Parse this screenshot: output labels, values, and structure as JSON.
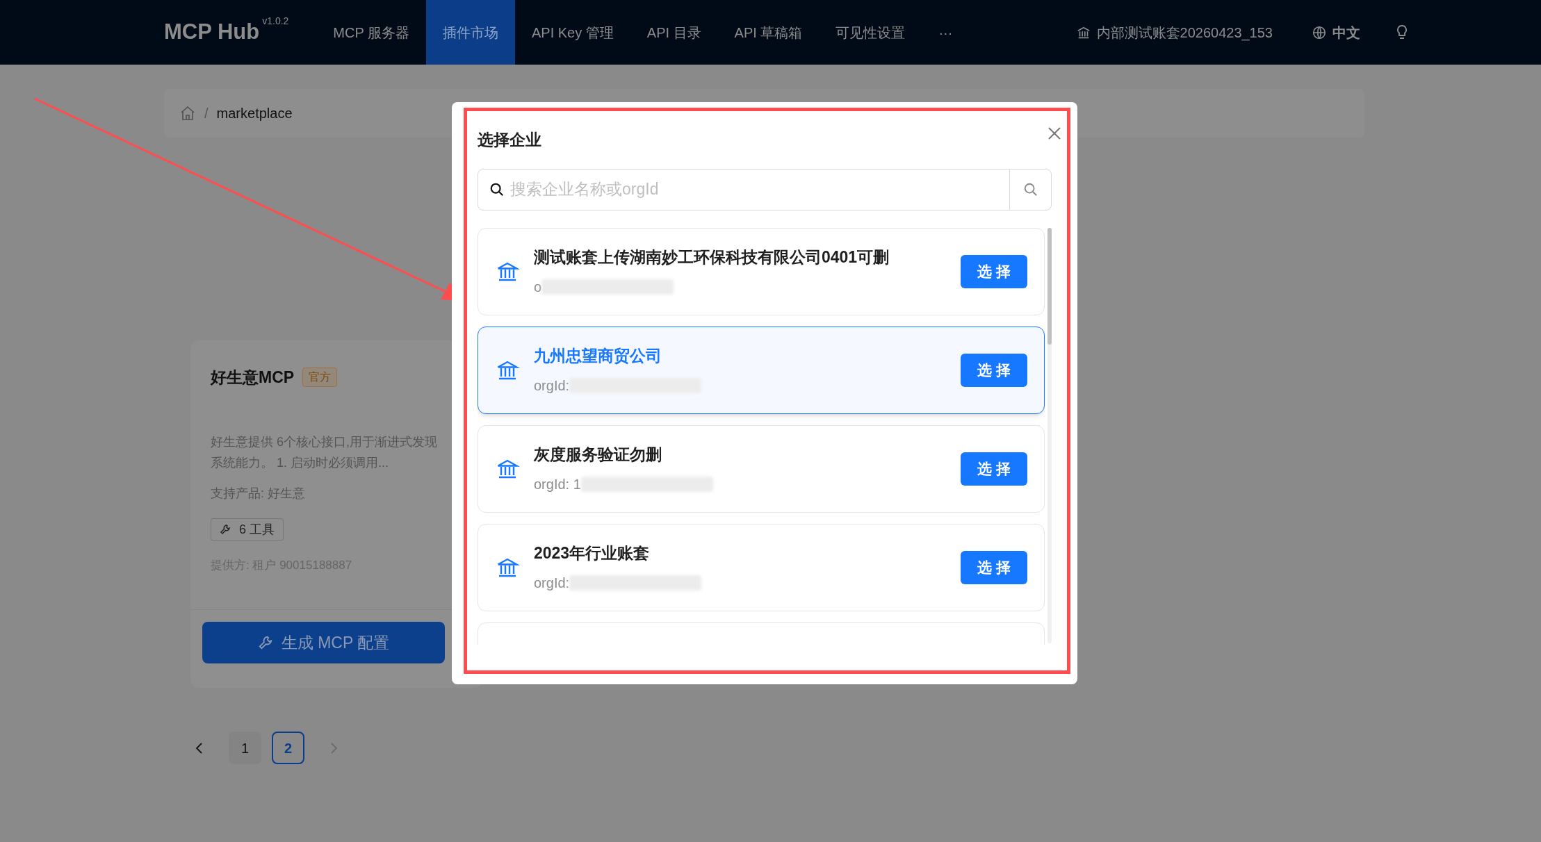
{
  "header": {
    "logo": "MCP Hub",
    "version": "v1.0.2",
    "nav": [
      {
        "label": "MCP 服务器",
        "selected": false
      },
      {
        "label": "插件市场",
        "selected": true
      },
      {
        "label": "API Key 管理",
        "selected": false
      },
      {
        "label": "API 目录",
        "selected": false
      },
      {
        "label": "API 草稿箱",
        "selected": false
      },
      {
        "label": "可见性设置",
        "selected": false
      }
    ],
    "more": "···",
    "account": "内部测试账套20260423_153",
    "language": "中文"
  },
  "breadcrumb": {
    "separator": "/",
    "items": [
      "marketplace"
    ]
  },
  "card": {
    "title": "好生意MCP",
    "badge": "官方",
    "description": "好生意提供 6个核心接口,用于渐进式发现系统能力。 1. 启动时必须调用...",
    "products": "支持产品: 好生意",
    "tools": "6 工具",
    "provider": "提供方: 租户 90015188887",
    "button": "生成 MCP 配置"
  },
  "pagination": {
    "pages": [
      {
        "label": "1",
        "selected": false
      },
      {
        "label": "2",
        "selected": true
      }
    ]
  },
  "modal": {
    "title": "选择企业",
    "search": {
      "placeholder": "搜索企业名称或orgId"
    },
    "items": [
      {
        "name": "测试账套上传湖南妙工环保科技有限公司0401可删",
        "org_id": "o",
        "selected": false,
        "button": "选 择"
      },
      {
        "name": "九州忠望商贸公司",
        "org_id": "orgId:",
        "selected": true,
        "button": "选 择"
      },
      {
        "name": "灰度服务验证勿删",
        "org_id": "orgId: 1",
        "selected": false,
        "button": "选 择"
      },
      {
        "name": "2023年行业账套",
        "org_id": "orgId:",
        "selected": false,
        "button": "选 择"
      }
    ]
  }
}
